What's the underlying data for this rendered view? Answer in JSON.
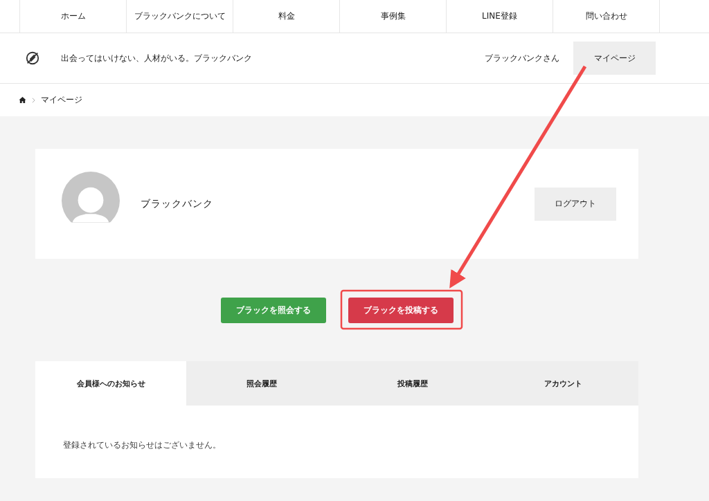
{
  "nav": {
    "items": [
      "ホーム",
      "ブラックバンクについて",
      "料金",
      "事例集",
      "LINE登録",
      "問い合わせ"
    ]
  },
  "header": {
    "tagline": "出会ってはいけない、人材がいる。ブラックバンク",
    "user": "ブラックバンクさん",
    "mypage_button": "マイページ"
  },
  "breadcrumb": {
    "current": "マイページ"
  },
  "profile": {
    "name": "ブラックバンク",
    "logout_button": "ログアウト"
  },
  "actions": [
    {
      "label": "ブラックを照会する",
      "kind": "inquire"
    },
    {
      "label": "ブラックを投稿する",
      "kind": "post"
    }
  ],
  "tabs": [
    {
      "label": "会員様へのお知らせ",
      "selected": true
    },
    {
      "label": "照会履歴",
      "selected": false
    },
    {
      "label": "投稿履歴",
      "selected": false
    },
    {
      "label": "アカウント",
      "selected": false
    }
  ],
  "notice": {
    "message": "登録されているお知らせはございません。"
  }
}
